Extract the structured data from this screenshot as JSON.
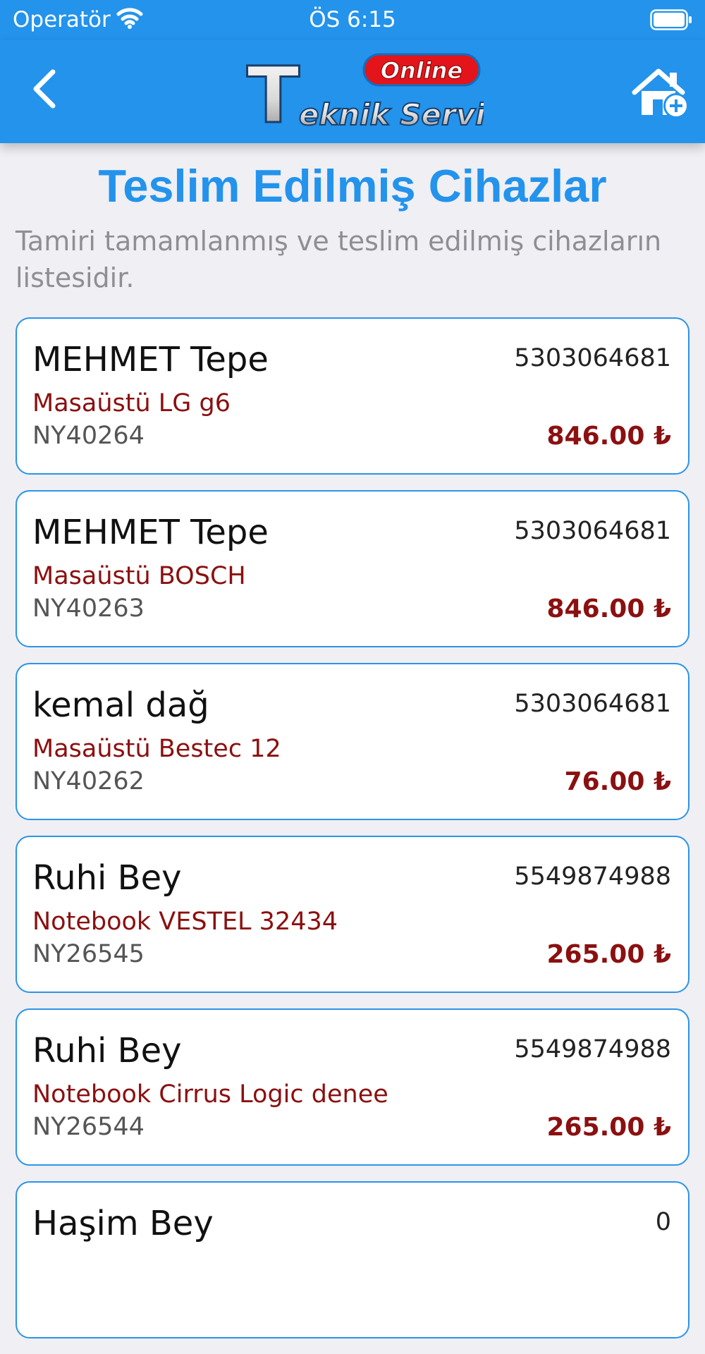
{
  "status_bar": {
    "carrier": "Operatör",
    "time": "ÖS 6:15"
  },
  "nav": {
    "back_icon": "chevron-left-icon",
    "logo_top": "Online",
    "logo_bottom": "eknik Servis",
    "logo_initial": "T",
    "action_icon": "home-add-icon"
  },
  "page": {
    "title": "Teslim Edilmiş Cihazlar",
    "subtitle": "Tamiri tamamlanmış ve teslim edilmiş cihazların listesidir."
  },
  "devices": [
    {
      "name": "MEHMET Tepe",
      "phone": "5303064681",
      "device": "Masaüstü LG g6",
      "code": "NY40264",
      "price": "846.00 ₺"
    },
    {
      "name": "MEHMET Tepe",
      "phone": "5303064681",
      "device": "Masaüstü BOSCH",
      "code": "NY40263",
      "price": "846.00 ₺"
    },
    {
      "name": "kemal dağ",
      "phone": "5303064681",
      "device": "Masaüstü Bestec 12",
      "code": "NY40262",
      "price": "76.00 ₺"
    },
    {
      "name": "Ruhi Bey",
      "phone": "5549874988",
      "device": "Notebook VESTEL 32434",
      "code": "NY26545",
      "price": "265.00 ₺"
    },
    {
      "name": "Ruhi Bey",
      "phone": "5549874988",
      "device": "Notebook Cirrus Logic denee",
      "code": "NY26544",
      "price": "265.00 ₺"
    },
    {
      "name": "Haşim Bey",
      "phone": "0",
      "device": "",
      "code": "",
      "price": ""
    }
  ],
  "colors": {
    "primary": "#2393ec",
    "price": "#8b1010",
    "background": "#efeff4"
  }
}
